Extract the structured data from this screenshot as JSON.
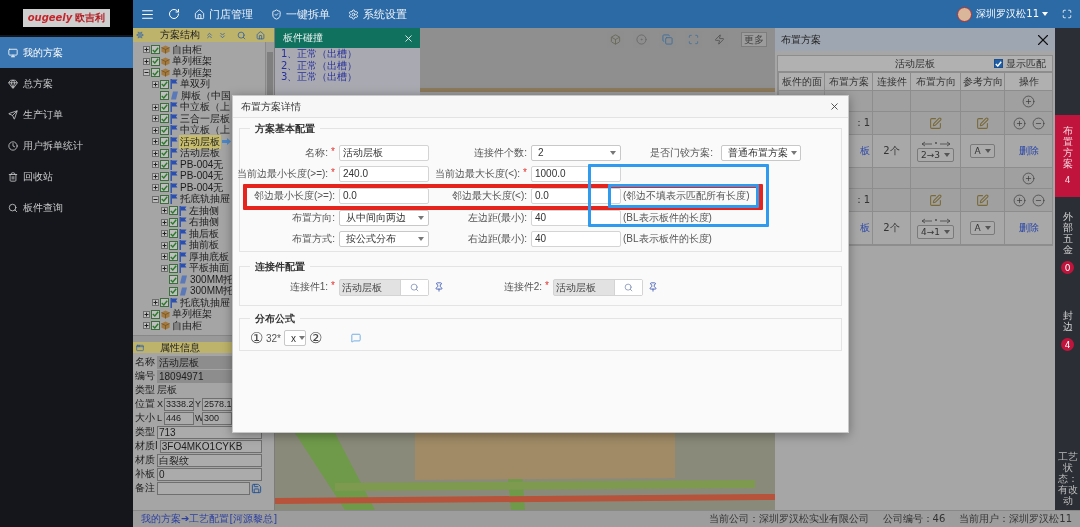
{
  "sidebar": {
    "logo": {
      "wordmark": "ougeely",
      "name": "欧吉利"
    },
    "items": [
      {
        "label": "我的方案",
        "selected": true
      },
      {
        "label": "总方案",
        "selected": false
      },
      {
        "label": "生产订单",
        "selected": false
      },
      {
        "label": "用户拆单统计",
        "selected": false
      },
      {
        "label": "回收站",
        "selected": false
      },
      {
        "label": "板件查询",
        "selected": false
      }
    ]
  },
  "topbar": {
    "nav": [
      {
        "label": "门店管理"
      },
      {
        "label": "一键拆单"
      },
      {
        "label": "系统设置"
      }
    ],
    "user": "深圳罗汉松11"
  },
  "tree": {
    "title": "方案结构",
    "nodes": [
      {
        "label": "自由柜",
        "kind": "cabinet",
        "checked": true,
        "selected": false,
        "expanded": false
      },
      {
        "label": "单列框架",
        "kind": "cabinet",
        "checked": true,
        "selected": false,
        "expanded": false
      },
      {
        "label": "单列框架",
        "kind": "cabinet",
        "checked": true,
        "selected": false,
        "expanded": true,
        "children": [
          {
            "label": "单双列",
            "kind": "part",
            "checked": true,
            "selected": false,
            "expanded": false
          },
          {
            "label": "脚板（中国",
            "kind": "panel",
            "checked": true,
            "selected": false
          },
          {
            "label": "中立板（上",
            "kind": "part",
            "checked": true,
            "selected": false,
            "expanded": false
          },
          {
            "label": "三合一层板",
            "kind": "part",
            "checked": true,
            "selected": false,
            "expanded": false
          },
          {
            "label": "中立板（上",
            "kind": "part",
            "checked": true,
            "selected": false,
            "expanded": false
          },
          {
            "label": "活动层板",
            "kind": "part",
            "checked": true,
            "selected": true,
            "expanded": false
          },
          {
            "label": "活动层板",
            "kind": "part",
            "checked": true,
            "selected": false,
            "expanded": false
          },
          {
            "label": "PB-004无",
            "kind": "part",
            "checked": true,
            "selected": false,
            "expanded": false
          },
          {
            "label": "PB-004无",
            "kind": "part",
            "checked": true,
            "selected": false,
            "expanded": false
          },
          {
            "label": "PB-004无",
            "kind": "part",
            "checked": true,
            "selected": false,
            "expanded": false
          },
          {
            "label": "托底轨抽屉",
            "kind": "part",
            "checked": true,
            "selected": false,
            "expanded": true,
            "children": [
              {
                "label": "左抽侧",
                "kind": "part",
                "checked": true,
                "selected": false,
                "expanded": false
              },
              {
                "label": "右抽侧",
                "kind": "part",
                "checked": true,
                "selected": false,
                "expanded": false
              },
              {
                "label": "抽后板",
                "kind": "part",
                "checked": true,
                "selected": false,
                "expanded": false
              },
              {
                "label": "抽前板",
                "kind": "part",
                "checked": true,
                "selected": false,
                "expanded": false
              },
              {
                "label": "厚抽底板",
                "kind": "part",
                "checked": true,
                "selected": false,
                "expanded": false
              },
              {
                "label": "平板抽面",
                "kind": "part",
                "checked": true,
                "selected": false,
                "expanded": false
              },
              {
                "label": "300MM托",
                "kind": "panel",
                "checked": true,
                "selected": false
              },
              {
                "label": "300MM托",
                "kind": "panel",
                "checked": true,
                "selected": false
              }
            ]
          },
          {
            "label": "托底轨抽屉",
            "kind": "part",
            "checked": true,
            "selected": false,
            "expanded": false
          }
        ]
      },
      {
        "label": "单列框架",
        "kind": "cabinet",
        "checked": true,
        "selected": false,
        "expanded": false
      },
      {
        "label": "自由柜",
        "kind": "cabinet",
        "checked": true,
        "selected": false,
        "expanded": false
      }
    ]
  },
  "properties": {
    "title": "属性信息",
    "rows": [
      {
        "label": "名称",
        "kind": "readonly",
        "value": "活动层板"
      },
      {
        "label": "编号",
        "kind": "readonly",
        "value": "18094971"
      },
      {
        "label": "类型",
        "kind": "plain",
        "value": "层板"
      },
      {
        "label": "位置",
        "kind": "pair",
        "fields": [
          {
            "prefix": "X",
            "value": "3338.2"
          },
          {
            "prefix": "Y",
            "value": "2578.1"
          }
        ]
      },
      {
        "label": "大小",
        "kind": "pair",
        "fields": [
          {
            "prefix": "L",
            "value": "446"
          },
          {
            "prefix": "W",
            "value": "300"
          }
        ]
      },
      {
        "label": "类型",
        "kind": "input",
        "value": "713"
      },
      {
        "label": "材质I",
        "kind": "input",
        "value": "3FO4MKO1CYKB"
      },
      {
        "label": "材质",
        "kind": "input",
        "value": "白裂纹"
      },
      {
        "label": "补板",
        "kind": "input",
        "value": "0"
      },
      {
        "label": "备注",
        "kind": "save"
      }
    ]
  },
  "collision": {
    "title": "板件碰撞",
    "items": [
      "1、正常（出槽）",
      "2、正常（出槽）",
      "3、正常（出槽）"
    ]
  },
  "viewer": {
    "more": "更多"
  },
  "layout_panel": {
    "title": "布置方案",
    "caption": "活动层板",
    "show_match": {
      "label": "显示匹配",
      "checked": true
    },
    "columns": [
      "板件的面",
      "布置方案",
      "连接件",
      "布置方向",
      "参考方向",
      "操作"
    ],
    "rows": [
      {
        "kind": "add"
      },
      {
        "kind": "face",
        "scheme": "：1"
      },
      {
        "kind": "scheme",
        "scheme": "板",
        "connectors": "2个",
        "direction": "2→3",
        "reference": "A",
        "action": "删除"
      },
      {
        "kind": "add"
      },
      {
        "kind": "face",
        "scheme": "：1"
      },
      {
        "kind": "scheme",
        "scheme": "板",
        "connectors": "2个",
        "direction": "4→1",
        "reference": "A",
        "action": "删除"
      }
    ]
  },
  "side_tabs": {
    "tabs": [
      {
        "label": "布置方案",
        "count": "4",
        "selected": true
      },
      {
        "label": "外部五金",
        "count": "0",
        "selected": false
      },
      {
        "label": "封边",
        "count": "4",
        "selected": false
      }
    ],
    "status": "工艺状态：有改动"
  },
  "status_bar": {
    "path": "我的方案➔工艺配置[河源黎总]",
    "company": "当前公司：深圳罗汉松实业有限公司",
    "company_no": "公司编号：46",
    "user": "当前用户：深圳罗汉松11"
  },
  "dialog": {
    "title": "布置方案详情",
    "basic": {
      "title": "方案基本配置",
      "rows": [
        [
          {
            "kind": "input",
            "label": "名称:",
            "mark": "*",
            "value": "活动层板"
          },
          {
            "kind": "select",
            "label": "连接件个数:",
            "value": "2"
          },
          {
            "kind": "select",
            "label": "是否门铰方案:",
            "value": "普通布置方案"
          }
        ],
        [
          {
            "kind": "input",
            "label": "当前边最小长度(>=):",
            "mark": "*",
            "value": "240.0"
          },
          {
            "kind": "input",
            "label": "当前边最大长度(<):",
            "mark": "*",
            "value": "1000.0"
          }
        ],
        [
          {
            "kind": "input",
            "label": "邻边最小长度(>=):",
            "value": "0.0"
          },
          {
            "kind": "input",
            "label": "邻边最大长度(<):",
            "value": "0.0"
          },
          {
            "kind": "note",
            "text": "(邻边不填表示匹配所有长度)"
          }
        ],
        [
          {
            "kind": "select",
            "label": "布置方向:",
            "value": "从中间向两边"
          },
          {
            "kind": "input",
            "label": "左边距(最小):",
            "value": "40"
          },
          {
            "kind": "note",
            "text": "(BL表示板件的长度)"
          }
        ],
        [
          {
            "kind": "select",
            "label": "布置方式:",
            "value": "按公式分布"
          },
          {
            "kind": "input",
            "label": "右边距(最小):",
            "value": "40"
          },
          {
            "kind": "note",
            "text": "(BL表示板件的长度)"
          }
        ]
      ]
    },
    "connectors": {
      "title": "连接件配置",
      "items": [
        {
          "label": "连接件1:",
          "mark": "*",
          "value": "活动层板"
        },
        {
          "label": "连接件2:",
          "mark": "*",
          "value": "活动层板"
        }
      ]
    },
    "formula": {
      "title": "分布公式",
      "parts": [
        {
          "kind": "operand",
          "text": "①"
        },
        {
          "kind": "text",
          "text": "32*"
        },
        {
          "kind": "select",
          "value": "x"
        },
        {
          "kind": "operand",
          "text": "②"
        }
      ]
    },
    "annotations": [
      {
        "color": "#e5241d"
      },
      {
        "color": "#2e9bee"
      },
      {
        "color": "#2e9bee"
      }
    ]
  }
}
